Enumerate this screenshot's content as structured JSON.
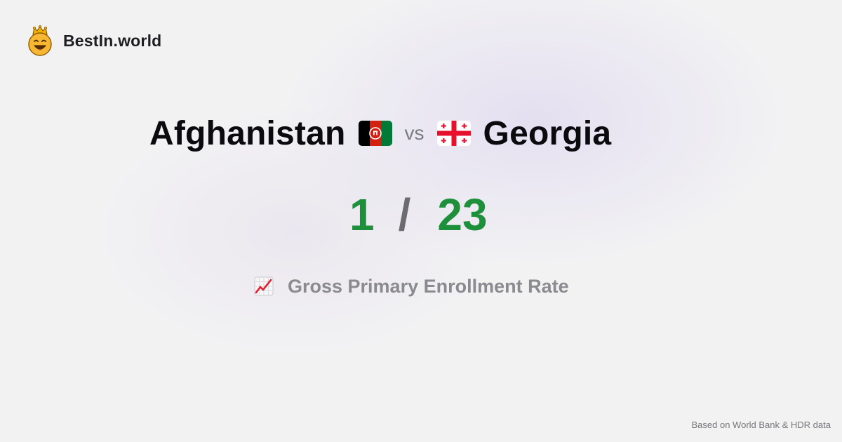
{
  "brand": {
    "name": "BestIn.world",
    "logo_icon": "smiling-crown-face-icon"
  },
  "comparison": {
    "country_a": {
      "name": "Afghanistan",
      "flag_icon": "afghanistan-flag-icon",
      "rank": "1"
    },
    "vs_label": "vs",
    "country_b": {
      "name": "Georgia",
      "flag_icon": "georgia-flag-icon",
      "rank": "23"
    },
    "separator": "/"
  },
  "metric": {
    "icon": "chart-increasing-icon",
    "label": "Gross Primary Enrollment Rate"
  },
  "footer": {
    "source_text": "Based on World Bank & HDR data"
  },
  "colors": {
    "rank_green": "#1e8f3b",
    "background": "#f2f2f3",
    "text_dark": "#0b0b0f",
    "muted": "#8a8a8f"
  }
}
